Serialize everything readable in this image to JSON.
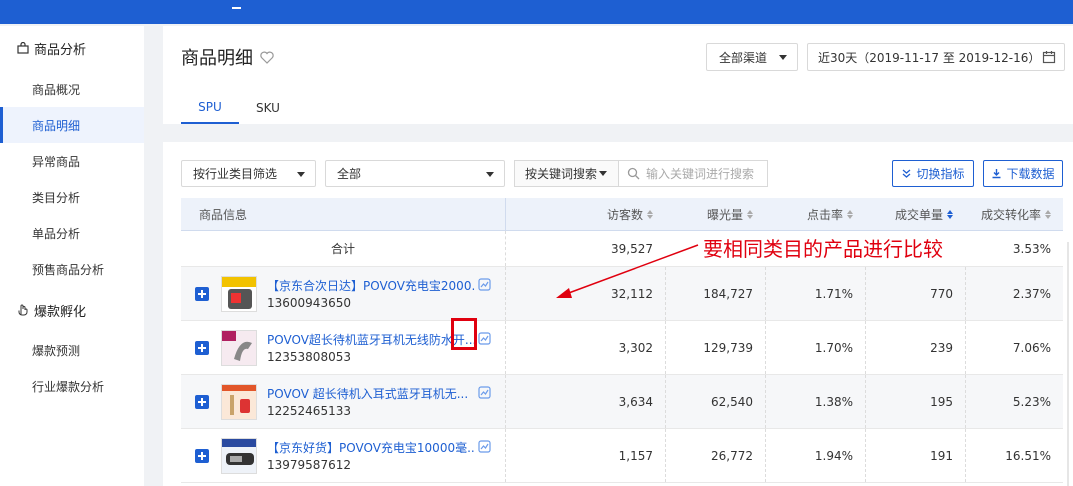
{
  "sidebar": {
    "groups": [
      {
        "label": "商品分析",
        "icon": "goods-bag-icon"
      },
      {
        "label": "爆款孵化",
        "icon": "hand-icon"
      }
    ],
    "items": [
      {
        "label": "商品概况"
      },
      {
        "label": "商品明细"
      },
      {
        "label": "异常商品"
      },
      {
        "label": "类目分析"
      },
      {
        "label": "单品分析"
      },
      {
        "label": "预售商品分析"
      },
      {
        "label": "爆款预测"
      },
      {
        "label": "行业爆款分析"
      }
    ],
    "active_index": 1
  },
  "header": {
    "title": "商品明细",
    "channel": "全部渠道",
    "date_range": "近30天（2019-11-17 至 2019-12-16）",
    "tabs": [
      {
        "label": "SPU"
      },
      {
        "label": "SKU"
      }
    ],
    "active_tab": 0
  },
  "filters": {
    "industry_select": "按行业类目筛选",
    "all_select": "全部",
    "keyword_mode": "按关键词搜索",
    "keyword_placeholder": "输入关键词进行搜索",
    "switch_metrics": "切换指标",
    "download": "下载数据"
  },
  "table": {
    "columns": [
      "商品信息",
      "访客数",
      "曝光量",
      "点击率",
      "成交单量",
      "成交转化率"
    ],
    "sorted_column": "成交单量",
    "total": {
      "label": "合计",
      "visitors": "39,527",
      "conversion": "3.53%"
    },
    "rows": [
      {
        "name": "【京东合次日达】POVOV充电宝2000...",
        "id": "13600943650",
        "visitors": "32,112",
        "exposure": "184,727",
        "ctr": "1.71%",
        "orders": "770",
        "conversion": "2.37%"
      },
      {
        "name": "POVOV超长待机蓝牙耳机无线防水开...",
        "id": "12353808053",
        "visitors": "3,302",
        "exposure": "129,739",
        "ctr": "1.70%",
        "orders": "239",
        "conversion": "7.06%"
      },
      {
        "name": "POVOV 超长待机入耳式蓝牙耳机无...",
        "id": "12252465133",
        "visitors": "3,634",
        "exposure": "62,540",
        "ctr": "1.38%",
        "orders": "195",
        "conversion": "5.23%"
      },
      {
        "name": "【京东好货】POVOV充电宝10000毫...",
        "id": "13979587612",
        "visitors": "1,157",
        "exposure": "26,772",
        "ctr": "1.94%",
        "orders": "191",
        "conversion": "16.51%"
      }
    ]
  },
  "annotation": {
    "text": "要相同类目的产品进行比较",
    "color": "#e0000f"
  },
  "colors": {
    "accent": "#1e5fd2",
    "topbar": "#1e5fd2",
    "annotation": "#e0000f"
  }
}
